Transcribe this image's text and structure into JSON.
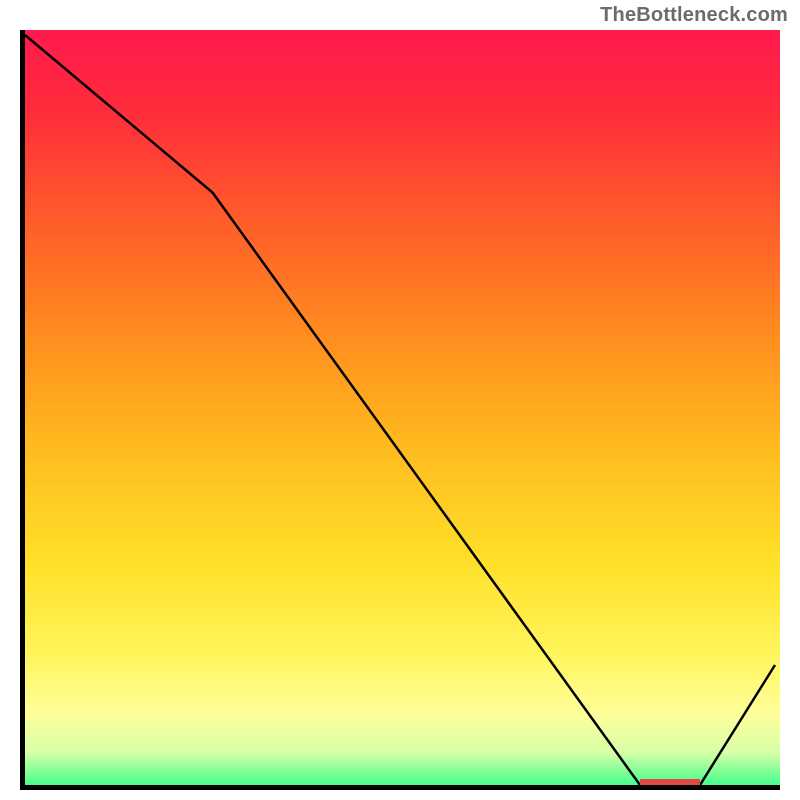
{
  "watermark": "TheBottleneck.com",
  "chart_data": {
    "type": "line",
    "title": "",
    "xlabel": "",
    "ylabel": "",
    "xlim": [
      0,
      100
    ],
    "ylim": [
      0,
      100
    ],
    "x": [
      0,
      25,
      82,
      90,
      100
    ],
    "y": [
      100,
      79,
      0,
      0,
      16
    ],
    "background_gradient": {
      "top": "#ff1a4d",
      "stops": [
        {
          "pos": 0.0,
          "color": "#ff1a4d"
        },
        {
          "pos": 0.1,
          "color": "#ff2a3c"
        },
        {
          "pos": 0.25,
          "color": "#ff5c2a"
        },
        {
          "pos": 0.4,
          "color": "#ff8c1f"
        },
        {
          "pos": 0.55,
          "color": "#ffbb1f"
        },
        {
          "pos": 0.7,
          "color": "#ffe029"
        },
        {
          "pos": 0.82,
          "color": "#fff55a"
        },
        {
          "pos": 0.9,
          "color": "#ffff9a"
        },
        {
          "pos": 0.95,
          "color": "#d9ffa7"
        },
        {
          "pos": 1.0,
          "color": "#2eff88"
        }
      ]
    },
    "marker": {
      "x_start": 82,
      "x_end": 90,
      "y": 0,
      "color": "#e04848"
    },
    "line_color": "#000000",
    "axis_color": "#000000"
  }
}
